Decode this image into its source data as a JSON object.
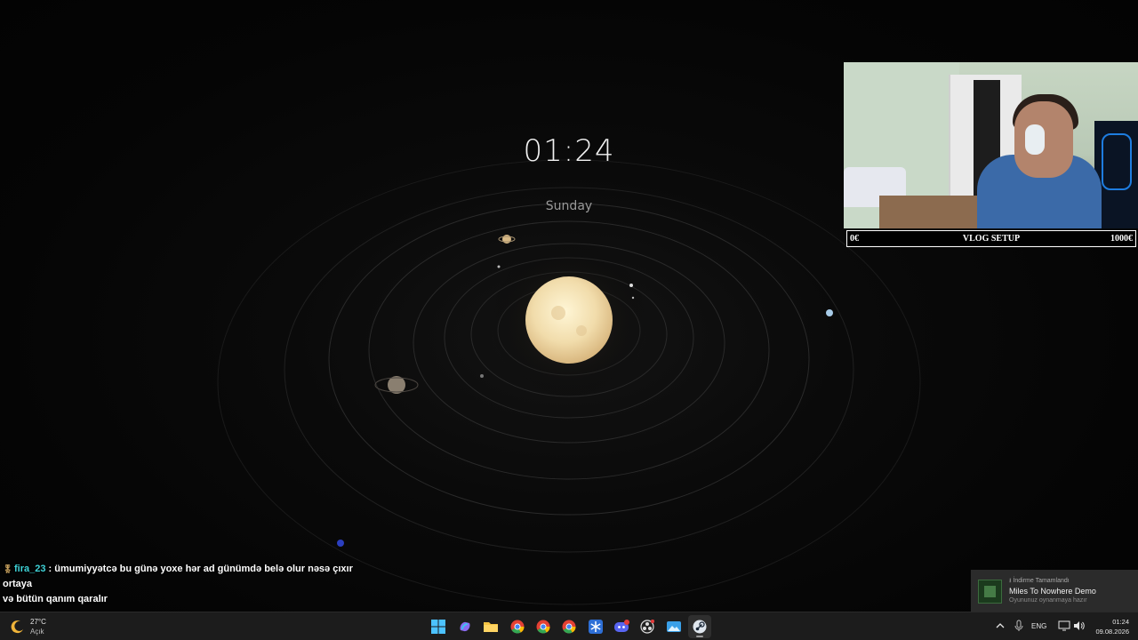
{
  "clock": {
    "time": "01:24",
    "day": "Sunday"
  },
  "overlay": {
    "vlog_bar": {
      "left": "0€",
      "center": "VLOG SETUP",
      "right": "1000€"
    },
    "progress": 0.0
  },
  "chat": {
    "username": "fira_23",
    "separator": " : ",
    "message_line1": "ümumiyyətcə bu günə yoxe hər ad günümdə belə olur nəsə çıxır ortaya",
    "message_line2": "və bütün qanım qaralır"
  },
  "notification": {
    "header": "İndirme Tamamlandı",
    "title": "Miles To Nowhere Demo",
    "subtitle": "Oyununuz oynanmaya hazır"
  },
  "taskbar": {
    "weather_temp": "27°C",
    "weather_condition": "Açık",
    "apps": [
      {
        "name": "windows-start-icon"
      },
      {
        "name": "copilot-icon"
      },
      {
        "name": "file-explorer-icon"
      },
      {
        "name": "chrome-icon"
      },
      {
        "name": "chrome-icon"
      },
      {
        "name": "chrome-icon"
      },
      {
        "name": "snowflake-app-icon"
      },
      {
        "name": "discord-icon"
      },
      {
        "name": "obs-icon"
      },
      {
        "name": "photos-icon"
      },
      {
        "name": "steam-icon"
      }
    ],
    "language": "ENG",
    "tray_time": "01:24",
    "tray_date": "09.08.2026"
  },
  "colors": {
    "chat_username": "#3fd3d8",
    "sun": "#f3e2b0",
    "taskbar_bg": "#1c1c1c"
  }
}
